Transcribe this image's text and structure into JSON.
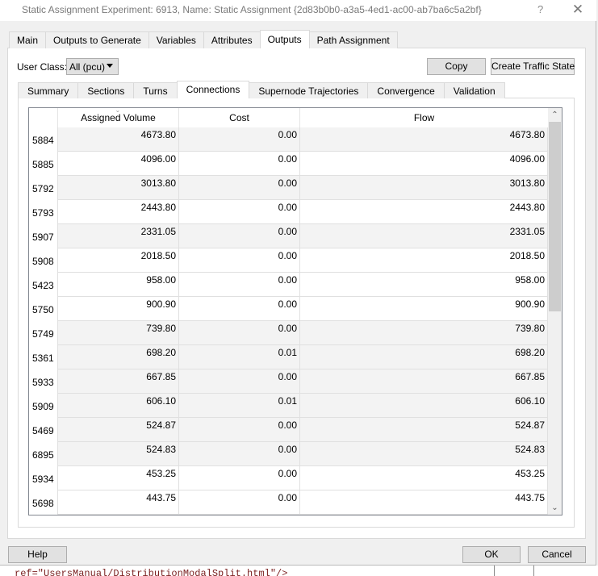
{
  "window": {
    "title": "Static Assignment Experiment: 6913, Name: Static Assignment  {2d83b0b0-a3a5-4ed1-ac00-ab7ba6c5a2bf}",
    "help_glyph": "?",
    "close_glyph": "✕"
  },
  "top_tabs": [
    {
      "label": "Main",
      "active": false
    },
    {
      "label": "Outputs to Generate",
      "active": false
    },
    {
      "label": "Variables",
      "active": false
    },
    {
      "label": "Attributes",
      "active": false
    },
    {
      "label": "Outputs",
      "active": true
    },
    {
      "label": "Path Assignment",
      "active": false
    }
  ],
  "user_class": {
    "label": "User Class:",
    "selected": "All (pcu)"
  },
  "toolbar": {
    "copy_label": "Copy",
    "create_traffic_state_label": "Create Traffic State"
  },
  "inner_tabs": [
    {
      "label": "Summary",
      "active": false
    },
    {
      "label": "Sections",
      "active": false
    },
    {
      "label": "Turns",
      "active": false
    },
    {
      "label": "Connections",
      "active": true
    },
    {
      "label": "Supernode Trajectories",
      "active": false
    },
    {
      "label": "Convergence",
      "active": false
    },
    {
      "label": "Validation",
      "active": false
    }
  ],
  "table": {
    "columns": [
      "Assigned Volume",
      "Cost",
      "Flow"
    ],
    "sorted_column": "Assigned Volume",
    "sort_glyph": "⌄",
    "rows": [
      {
        "id": "5884",
        "assigned_volume": "4673.80",
        "cost": "0.00",
        "flow": "4673.80",
        "shaded": true
      },
      {
        "id": "5885",
        "assigned_volume": "4096.00",
        "cost": "0.00",
        "flow": "4096.00",
        "shaded": false
      },
      {
        "id": "5792",
        "assigned_volume": "3013.80",
        "cost": "0.00",
        "flow": "3013.80",
        "shaded": true
      },
      {
        "id": "5793",
        "assigned_volume": "2443.80",
        "cost": "0.00",
        "flow": "2443.80",
        "shaded": false
      },
      {
        "id": "5907",
        "assigned_volume": "2331.05",
        "cost": "0.00",
        "flow": "2331.05",
        "shaded": true
      },
      {
        "id": "5908",
        "assigned_volume": "2018.50",
        "cost": "0.00",
        "flow": "2018.50",
        "shaded": false
      },
      {
        "id": "5423",
        "assigned_volume": "958.00",
        "cost": "0.00",
        "flow": "958.00",
        "shaded": false
      },
      {
        "id": "5750",
        "assigned_volume": "900.90",
        "cost": "0.00",
        "flow": "900.90",
        "shaded": false
      },
      {
        "id": "5749",
        "assigned_volume": "739.80",
        "cost": "0.00",
        "flow": "739.80",
        "shaded": true
      },
      {
        "id": "5361",
        "assigned_volume": "698.20",
        "cost": "0.01",
        "flow": "698.20",
        "shaded": true
      },
      {
        "id": "5933",
        "assigned_volume": "667.85",
        "cost": "0.00",
        "flow": "667.85",
        "shaded": true
      },
      {
        "id": "5909",
        "assigned_volume": "606.10",
        "cost": "0.01",
        "flow": "606.10",
        "shaded": true
      },
      {
        "id": "5469",
        "assigned_volume": "524.87",
        "cost": "0.00",
        "flow": "524.87",
        "shaded": true
      },
      {
        "id": "6895",
        "assigned_volume": "524.83",
        "cost": "0.00",
        "flow": "524.83",
        "shaded": true
      },
      {
        "id": "5934",
        "assigned_volume": "453.25",
        "cost": "0.00",
        "flow": "453.25",
        "shaded": false
      },
      {
        "id": "5698",
        "assigned_volume": "443.75",
        "cost": "0.00",
        "flow": "443.75",
        "shaded": false
      }
    ],
    "scroll": {
      "position_fraction": 0.0,
      "visible_fraction": 0.5
    }
  },
  "footer": {
    "help_label": "Help",
    "ok_label": "OK",
    "cancel_label": "Cancel"
  },
  "background": {
    "partial_text": "ref=\"UsersManual/DistributionModalSplit.html\"/>"
  },
  "icons": {
    "scroll_up": "⌃",
    "scroll_down": "⌄"
  }
}
